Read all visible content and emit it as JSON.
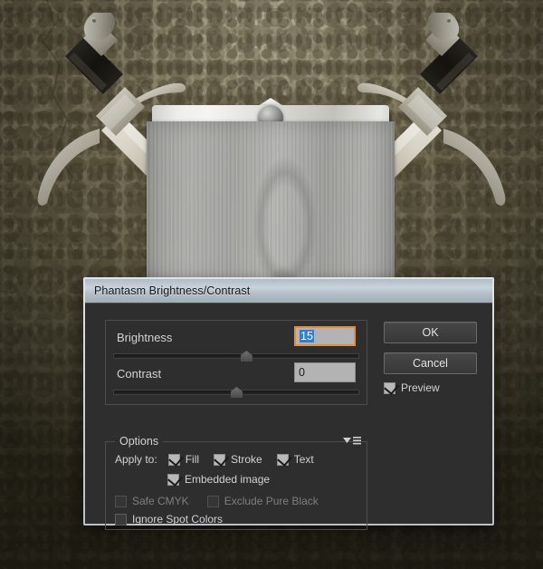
{
  "dialog": {
    "title": "Phantasm Brightness/Contrast",
    "fields": [
      {
        "label": "Brightness",
        "value": "15",
        "selected": true,
        "thumb_pct": 54
      },
      {
        "label": "Contrast",
        "value": "0",
        "selected": false,
        "thumb_pct": 50
      }
    ],
    "buttons": {
      "ok": "OK",
      "cancel": "Cancel"
    },
    "preview": {
      "label": "Preview",
      "checked": true
    },
    "options": {
      "legend": "Options",
      "flyout_icon": "flyout-menu-icon",
      "apply_to_label": "Apply to:",
      "apply_to": [
        {
          "label": "Fill",
          "checked": true,
          "disabled": false
        },
        {
          "label": "Stroke",
          "checked": true,
          "disabled": false
        },
        {
          "label": "Text",
          "checked": true,
          "disabled": false
        }
      ],
      "embedded": {
        "label": "Embedded image",
        "checked": true,
        "disabled": false
      },
      "secondary": [
        {
          "label": "Safe CMYK",
          "checked": false,
          "disabled": true
        },
        {
          "label": "Exclude Pure Black",
          "checked": false,
          "disabled": true
        }
      ],
      "spot": {
        "label": "Ignore Spot Colors",
        "checked": false,
        "disabled": false
      }
    }
  },
  "background": {
    "scene": "crossed-swords-over-wooden-shield-on-stone-wall",
    "wall_color": "#6f6a53",
    "plaque_color": "#a8a8a5",
    "metal_color": "#e3e3df"
  },
  "colors": {
    "accent_focus": "#e0903c",
    "selection_blue": "#2b7fe0",
    "dialog_bg": "#2e2e2e",
    "titlebar": "#c9d3da",
    "text": "#d2d2d2",
    "text_disabled": "#7e7e7e"
  }
}
